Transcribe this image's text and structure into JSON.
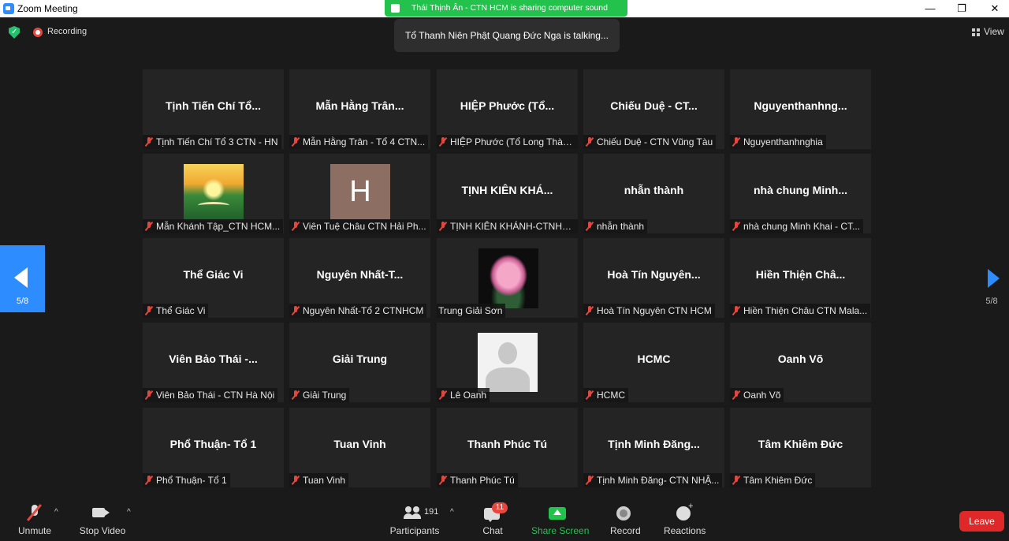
{
  "window": {
    "title": "Zoom Meeting",
    "minimize_glyph": "—",
    "maximize_glyph": "❐",
    "close_glyph": "✕"
  },
  "share_banner": {
    "text": "Thái Thịnh Ân - CTN HCM is sharing computer sound"
  },
  "top_bar": {
    "recording_label": "Recording",
    "talking_indicator": "Tổ Thanh Niên Phật Quang Đức Nga is talking...",
    "view_label": "View",
    "security_check": "✓"
  },
  "pagination": {
    "left_page": "5/8",
    "right_page": "5/8"
  },
  "tiles": [
    {
      "big": "Tịnh Tiến Chí Tổ...",
      "tag": "Tịnh Tiến Chí Tổ 3 CTN - HN",
      "muted": true,
      "picture": ""
    },
    {
      "big": "Mẫn Hằng Trân...",
      "tag": "Mẫn Hằng Trân - Tổ 4 CTN...",
      "muted": true,
      "picture": ""
    },
    {
      "big": "HIỆP Phước (Tổ...",
      "tag": "HIỆP Phước (Tổ  Long Thàn...",
      "muted": true,
      "picture": ""
    },
    {
      "big": "Chiếu Duệ - CT...",
      "tag": "Chiếu Duệ - CTN Vũng Tàu",
      "muted": true,
      "picture": ""
    },
    {
      "big": "Nguyenthanhng...",
      "tag": "Nguyenthanhnghia",
      "muted": true,
      "picture": ""
    },
    {
      "big": "",
      "tag": "Mẫn Khánh Tập_CTN HCM...",
      "muted": true,
      "picture": "scenery"
    },
    {
      "big": "",
      "tag": "Viên Tuệ Châu CTN Hải Ph...",
      "muted": true,
      "picture": "letter",
      "letter": "H"
    },
    {
      "big": "TỊNH KIÊN KHÁ...",
      "tag": "TỊNH KIÊN KHÁNH-CTNHC...",
      "muted": true,
      "picture": ""
    },
    {
      "big": "nhẫn thành",
      "tag": "nhẫn thành",
      "muted": true,
      "picture": ""
    },
    {
      "big": "nhà chung Minh...",
      "tag": "nhà chung Minh Khai - CT...",
      "muted": true,
      "picture": ""
    },
    {
      "big": "Thể Giác Vi",
      "tag": "Thể Giác Vi",
      "muted": true,
      "picture": ""
    },
    {
      "big": "Nguyên  Nhất-T...",
      "tag": "Nguyên Nhất-Tổ 2 CTNHCM",
      "muted": true,
      "picture": ""
    },
    {
      "big": "",
      "tag": "Trung Giải Sơn",
      "muted": false,
      "picture": "lotus"
    },
    {
      "big": "Hoà Tín Nguyên...",
      "tag": "Hoà Tín Nguyên CTN HCM",
      "muted": true,
      "picture": ""
    },
    {
      "big": "Hiền Thiện Châ...",
      "tag": "Hiền Thiện Châu CTN Mala...",
      "muted": true,
      "picture": ""
    },
    {
      "big": "Viên Bảo Thái -...",
      "tag": "Viên Bảo Thái - CTN Hà Nội",
      "muted": true,
      "picture": ""
    },
    {
      "big": "Giải Trung",
      "tag": "Giải Trung",
      "muted": true,
      "picture": ""
    },
    {
      "big": "",
      "tag": "Lê Oanh",
      "muted": true,
      "picture": "avatar"
    },
    {
      "big": "HCMC",
      "tag": "HCMC",
      "muted": true,
      "picture": ""
    },
    {
      "big": "Oanh Võ",
      "tag": "Oanh Võ",
      "muted": true,
      "picture": ""
    },
    {
      "big": "Phổ Thuận- Tổ 1",
      "tag": "Phổ Thuận- Tổ 1",
      "muted": true,
      "picture": ""
    },
    {
      "big": "Tuan Vinh",
      "tag": "Tuan Vinh",
      "muted": true,
      "picture": ""
    },
    {
      "big": "Thanh Phúc Tú",
      "tag": "Thanh Phúc Tú",
      "muted": true,
      "picture": ""
    },
    {
      "big": "Tịnh Minh Đăng...",
      "tag": "Tịnh Minh Đăng- CTN NHẬ...",
      "muted": true,
      "picture": ""
    },
    {
      "big": "Tâm Khiêm Đức",
      "tag": "Tâm Khiêm Đức",
      "muted": true,
      "picture": ""
    }
  ],
  "toolbar": {
    "unmute": "Unmute",
    "stop_video": "Stop Video",
    "participants": "Participants",
    "participants_count": "191",
    "chat": "Chat",
    "chat_badge": "11",
    "share_screen": "Share Screen",
    "record": "Record",
    "reactions": "Reactions",
    "leave": "Leave",
    "chevron": "^"
  },
  "colors": {
    "accent_blue": "#2d8cff",
    "share_green": "#23c24d",
    "leave_red": "#e02828",
    "muted_red": "#e5473f",
    "tile_bg": "#242424"
  }
}
